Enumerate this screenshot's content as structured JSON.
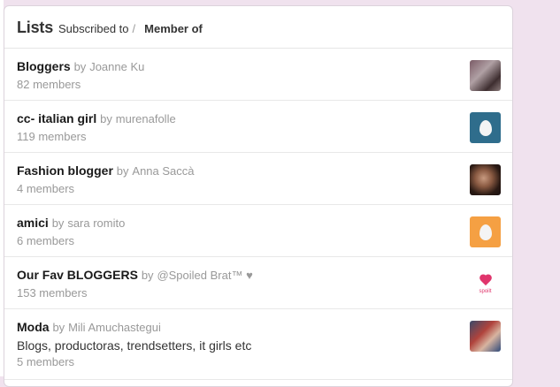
{
  "header": {
    "title": "Lists",
    "tab_subscribed": "Subscribed to",
    "separator": "/",
    "tab_member": "Member of"
  },
  "lists": [
    {
      "name": "Bloggers",
      "by": "by",
      "owner": "Joanne Ku",
      "description": "",
      "members": "82 members",
      "avatar": "profile-photo"
    },
    {
      "name": "cc- italian girl",
      "by": "by",
      "owner": "murenafolle",
      "description": "",
      "members": "119 members",
      "avatar": "default-egg-blue"
    },
    {
      "name": "Fashion blogger",
      "by": "by",
      "owner": "Anna Saccà",
      "description": "",
      "members": "4 members",
      "avatar": "profile-photo"
    },
    {
      "name": "amici",
      "by": "by",
      "owner": "sara romito",
      "description": "",
      "members": "6 members",
      "avatar": "default-egg-orange"
    },
    {
      "name": "Our Fav BLOGGERS",
      "by": "by",
      "owner": "@Spoiled Brat™ ♥",
      "description": "",
      "members": "153 members",
      "avatar": "heart-logo",
      "avatar_text": "spoilt"
    },
    {
      "name": "Moda",
      "by": "by",
      "owner": "Mili Amuchastegui",
      "description": "Blogs, productoras, trendsetters, it girls etc",
      "members": "5 members",
      "avatar": "profile-photo"
    }
  ],
  "colors": {
    "background": "#f0e2ee",
    "egg_blue": "#2f6d8c",
    "egg_orange": "#f5a043",
    "heart": "#e0356c"
  }
}
